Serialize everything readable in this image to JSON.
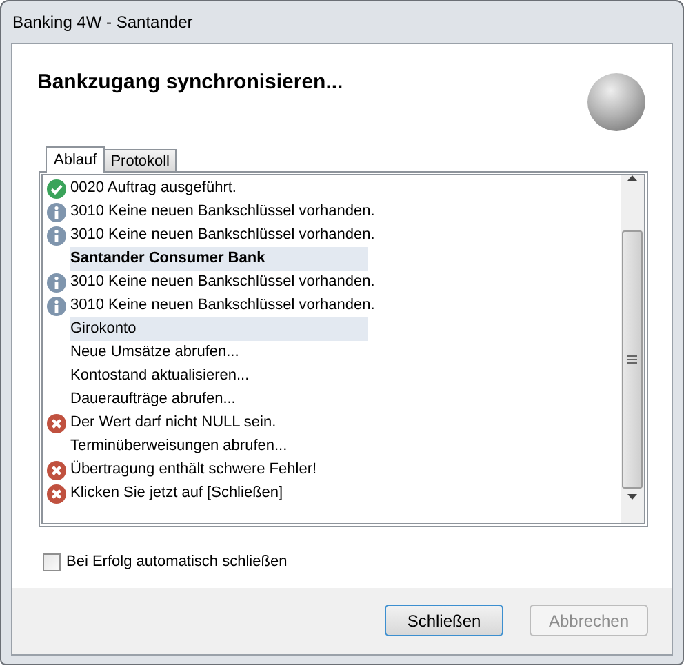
{
  "window": {
    "title": "Banking 4W - Santander"
  },
  "heading": "Bankzugang synchronisieren...",
  "tabs": [
    {
      "label": "Ablauf",
      "selected": true
    },
    {
      "label": "Protokoll",
      "selected": false
    }
  ],
  "log": [
    {
      "kind": "success",
      "text": "0020 Auftrag ausgeführt."
    },
    {
      "kind": "info",
      "text": "3010 Keine neuen Bankschlüssel vorhanden."
    },
    {
      "kind": "info",
      "text": "3010 Keine neuen Bankschlüssel vorhanden."
    },
    {
      "kind": "header",
      "text": "Santander Consumer Bank"
    },
    {
      "kind": "info",
      "text": "3010 Keine neuen Bankschlüssel vorhanden."
    },
    {
      "kind": "info",
      "text": "3010 Keine neuen Bankschlüssel vorhanden."
    },
    {
      "kind": "subheader",
      "text": "Girokonto"
    },
    {
      "kind": "plain",
      "text": "Neue Umsätze abrufen..."
    },
    {
      "kind": "plain",
      "text": "Kontostand aktualisieren..."
    },
    {
      "kind": "plain",
      "text": "Daueraufträge abrufen..."
    },
    {
      "kind": "error",
      "text": "Der Wert darf nicht NULL sein."
    },
    {
      "kind": "plain",
      "text": "Terminüberweisungen abrufen..."
    },
    {
      "kind": "error",
      "text": "Übertragung enthält schwere Fehler!"
    },
    {
      "kind": "error",
      "text": "Klicken Sie jetzt auf [Schließen]"
    }
  ],
  "auto_close": {
    "label": "Bei Erfolg automatisch schließen",
    "checked": false
  },
  "buttons": [
    {
      "label": "Schließen",
      "disabled": false
    },
    {
      "label": "Abbrechen",
      "disabled": true
    }
  ]
}
